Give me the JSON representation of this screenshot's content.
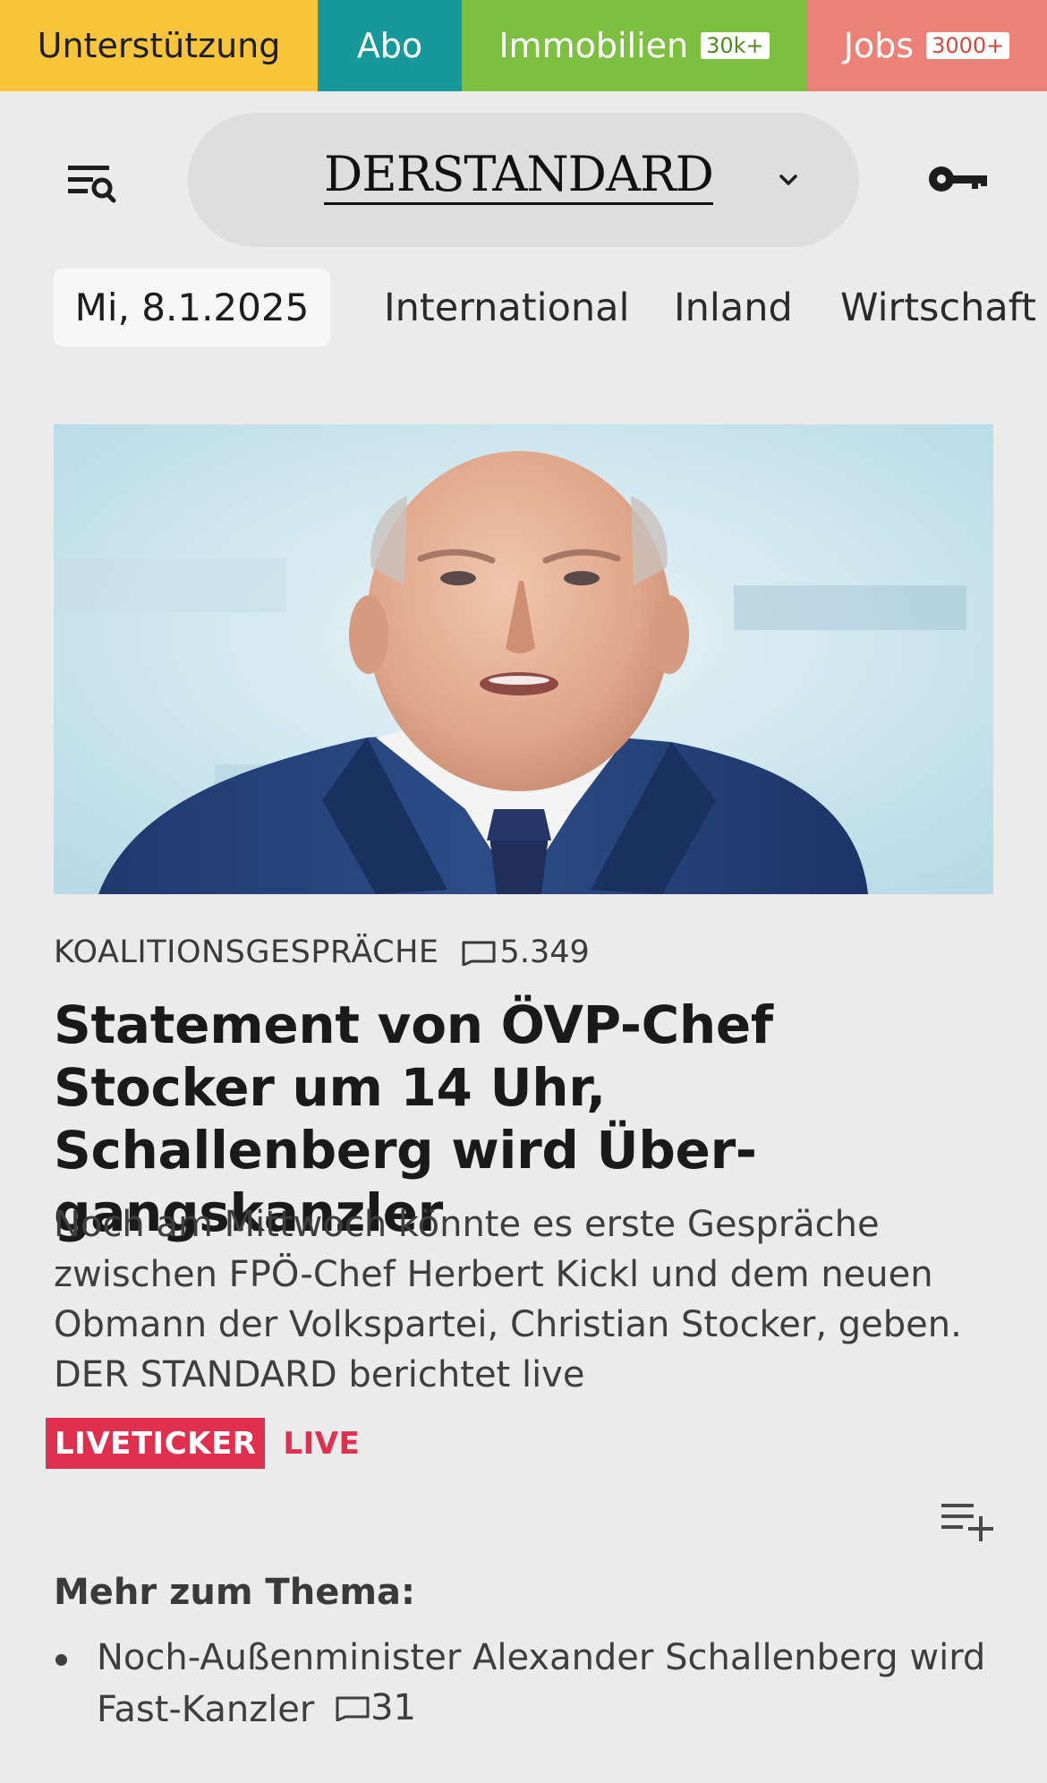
{
  "promo_bar": {
    "support_label": "Unterstützung",
    "abo_label": "Abo",
    "immobilien_label": "Immobilien",
    "immobilien_badge": "30k+",
    "jobs_label": "Jobs",
    "jobs_badge": "3000+",
    "colors": {
      "support": "#f8c53a",
      "abo": "#17989a",
      "immobilien": "#7dbf40",
      "jobs": "#ec8277"
    }
  },
  "header": {
    "logo_text": "DERSTANDARD",
    "menu_icon": "menu-search-icon",
    "dropdown_icon": "chevron-down-icon",
    "login_icon": "key-icon"
  },
  "section_nav": {
    "date": "Mi, 8.1.2025",
    "links": [
      "International",
      "Inland",
      "Wirtschaft"
    ]
  },
  "article": {
    "kicker": "KOALITIONSGESPRÄCHE",
    "comment_count": "5.349",
    "headline": "Statement von ÖVP-Chef Stocker um 14 Uhr, Schallenberg wird Über­gangskanzler",
    "teaser": "Noch am Mittwoch könnte es erste Gespräche zwischen FPÖ-Chef Herbert Kickl und dem neuen Obmann der Volkspartei, Christian Stocker, geben. DER STANDARD berichtet live",
    "live_badge": "LIVETICKER",
    "live_label": "LIVE",
    "live_color": "#e0304f"
  },
  "more": {
    "heading": "Mehr zum Thema:",
    "items": [
      {
        "title": "Noch-Außenminister Alexander Schallenberg wird Fast-Kanzler",
        "comments": "31"
      }
    ]
  }
}
